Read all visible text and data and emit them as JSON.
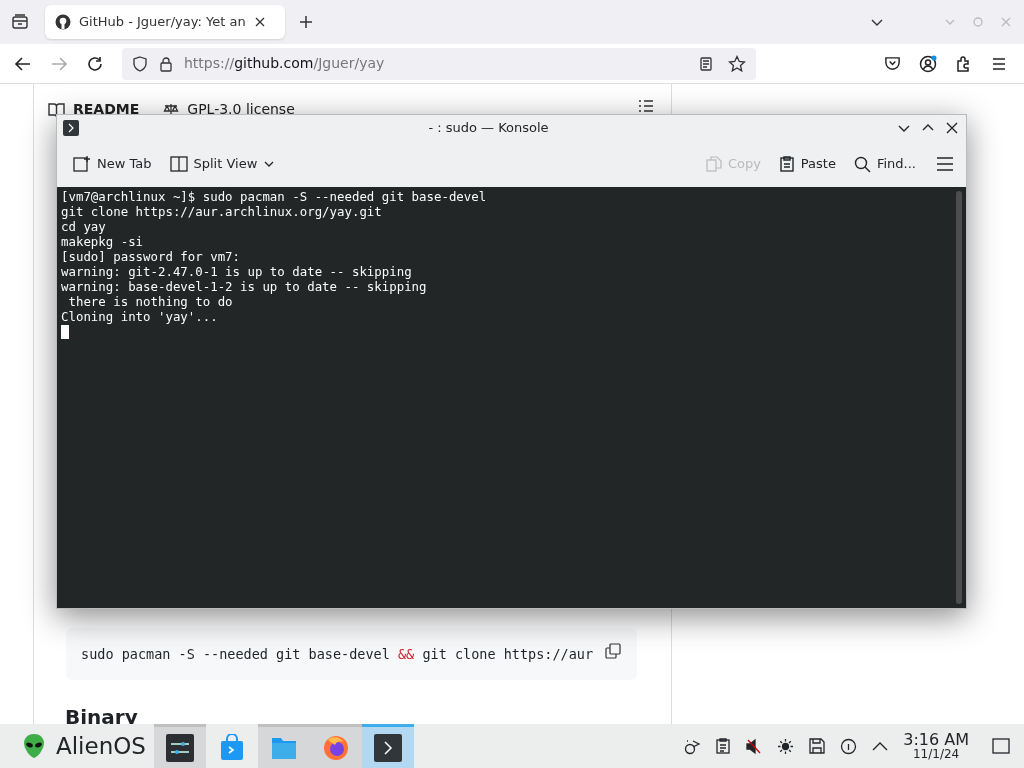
{
  "browser": {
    "tab_title": "GitHub - Jguer/yay: Yet an",
    "url": {
      "scheme": "https://",
      "host": "github.com",
      "path": "/Jguer/yay"
    }
  },
  "page": {
    "readme_tab": "README",
    "license_tab": "GPL-3.0 license",
    "code_block": [
      {
        "kind": "text",
        "text": "sudo pacman -S --needed git base-devel "
      },
      {
        "kind": "operator",
        "text": "&&"
      },
      {
        "kind": "text",
        "text": " git clone https://aur"
      }
    ],
    "heading": "Binary"
  },
  "konsole": {
    "title": "- : sudo — Konsole",
    "toolbar": [
      {
        "label": "New Tab",
        "kind": "newtab",
        "disabled": false
      },
      {
        "label": "Split View",
        "kind": "split",
        "disabled": false
      }
    ],
    "toolbar_right": [
      {
        "label": "Copy",
        "kind": "copy",
        "disabled": true
      },
      {
        "label": "Paste",
        "kind": "paste",
        "disabled": false
      },
      {
        "label": "Find...",
        "kind": "find",
        "disabled": false
      }
    ],
    "lines": [
      "[vm7@archlinux ~]$ sudo pacman -S --needed git base-devel",
      "git clone https://aur.archlinux.org/yay.git",
      "cd yay",
      "makepkg -si",
      "[sudo] password for vm7:",
      "warning: git-2.47.0-1 is up to date -- skipping",
      "warning: base-devel-1-2 is up to date -- skipping",
      " there is nothing to do",
      "Cloning into 'yay'..."
    ]
  },
  "taskbar": {
    "launcher": "AlienOS",
    "tasks": [
      {
        "kind": "settings",
        "open": true,
        "selected": false
      },
      {
        "kind": "store",
        "open": false,
        "selected": false
      },
      {
        "kind": "files",
        "open": true,
        "selected": false
      },
      {
        "kind": "firefox",
        "open": true,
        "selected": false
      },
      {
        "kind": "terminal",
        "open": true,
        "selected": true
      }
    ],
    "time": "3:16 AM",
    "date": "11/1/24"
  }
}
